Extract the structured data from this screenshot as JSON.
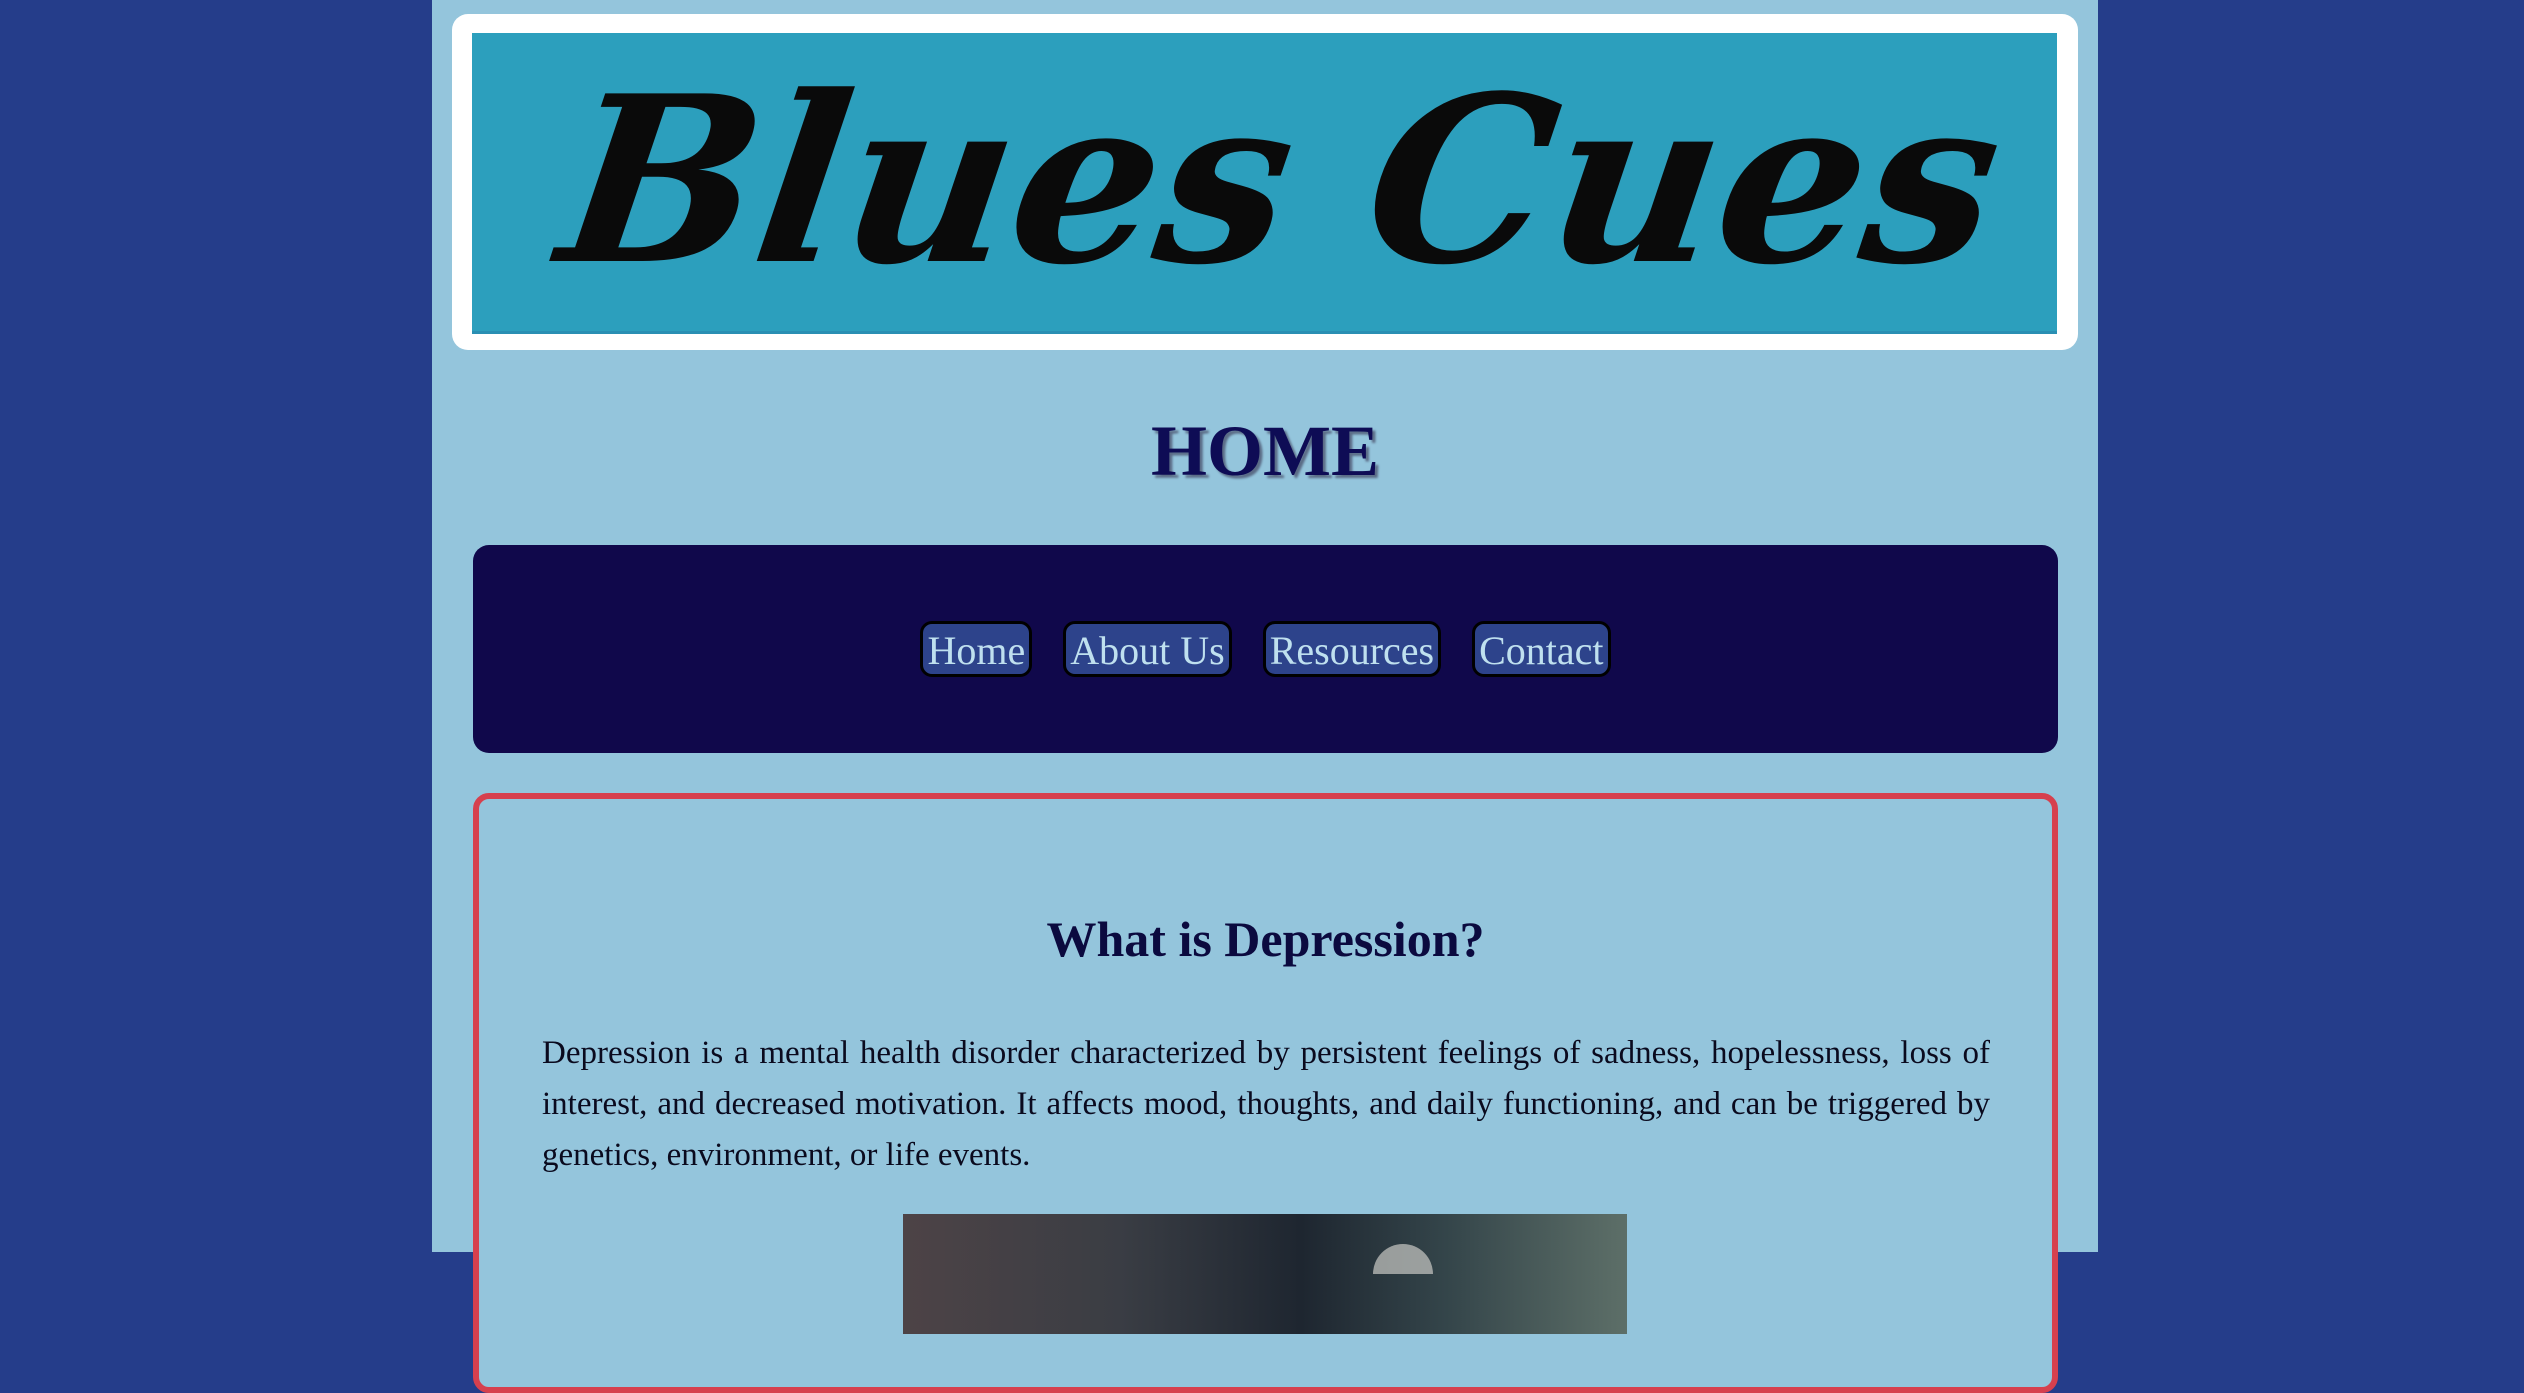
{
  "banner": {
    "logo_text": "Blues Cues"
  },
  "page": {
    "heading": "HOME"
  },
  "nav": {
    "items": [
      {
        "label": "Home"
      },
      {
        "label": "About Us"
      },
      {
        "label": "Resources"
      },
      {
        "label": "Contact"
      }
    ]
  },
  "content": {
    "heading": "What is Depression?",
    "paragraph": "Depression is a mental health disorder characterized by persistent feelings of sadness, hopelessness, loss of interest, and decreased motivation. It affects mood, thoughts, and daily functioning, and can be triggered by genetics, environment, or life events."
  },
  "colors": {
    "outer_background": "#253d8a",
    "page_background": "#94c5dc",
    "banner_background": "#2c9fbd",
    "nav_background": "#10084b",
    "nav_button": "#2d438b",
    "nav_text": "#bfe0ef",
    "heading": "#0e0c55",
    "card_border": "#d6404e"
  }
}
